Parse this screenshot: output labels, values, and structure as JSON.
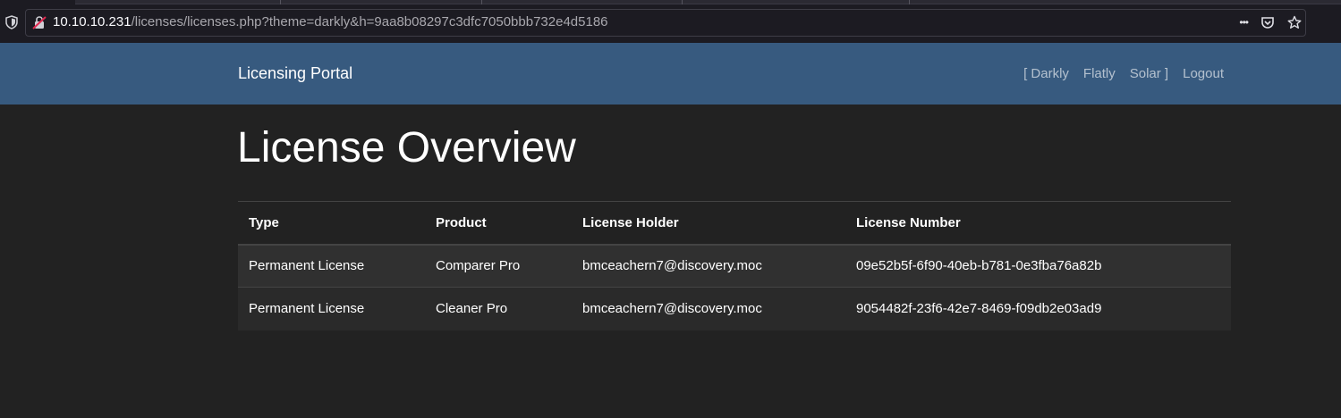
{
  "browser": {
    "url_host": "10.10.10.231",
    "url_path": "/licenses/licenses.php?theme=darkly&h=9aa8b08297c3dfc7050bbb732e4d5186",
    "menu_glyph": "•••"
  },
  "navbar": {
    "brand": "Licensing Portal",
    "links": [
      {
        "label": "[ Darkly"
      },
      {
        "label": "Flatly"
      },
      {
        "label": "Solar ]"
      },
      {
        "label": "Logout"
      }
    ]
  },
  "main": {
    "title": "License Overview",
    "table": {
      "columns": [
        "Type",
        "Product",
        "License Holder",
        "License Number"
      ],
      "rows": [
        [
          "Permanent License",
          "Comparer Pro",
          "bmceachern7@discovery.moc",
          "09e52b5f-6f90-40eb-b781-0e3fba76a82b"
        ],
        [
          "Permanent License",
          "Cleaner Pro",
          "bmceachern7@discovery.moc",
          "9054482f-23f6-42e7-8469-f09db2e03ad9"
        ]
      ]
    }
  },
  "colors": {
    "navbar_bg": "#375a7f",
    "page_bg": "#222222",
    "row_odd_bg": "#303030"
  }
}
